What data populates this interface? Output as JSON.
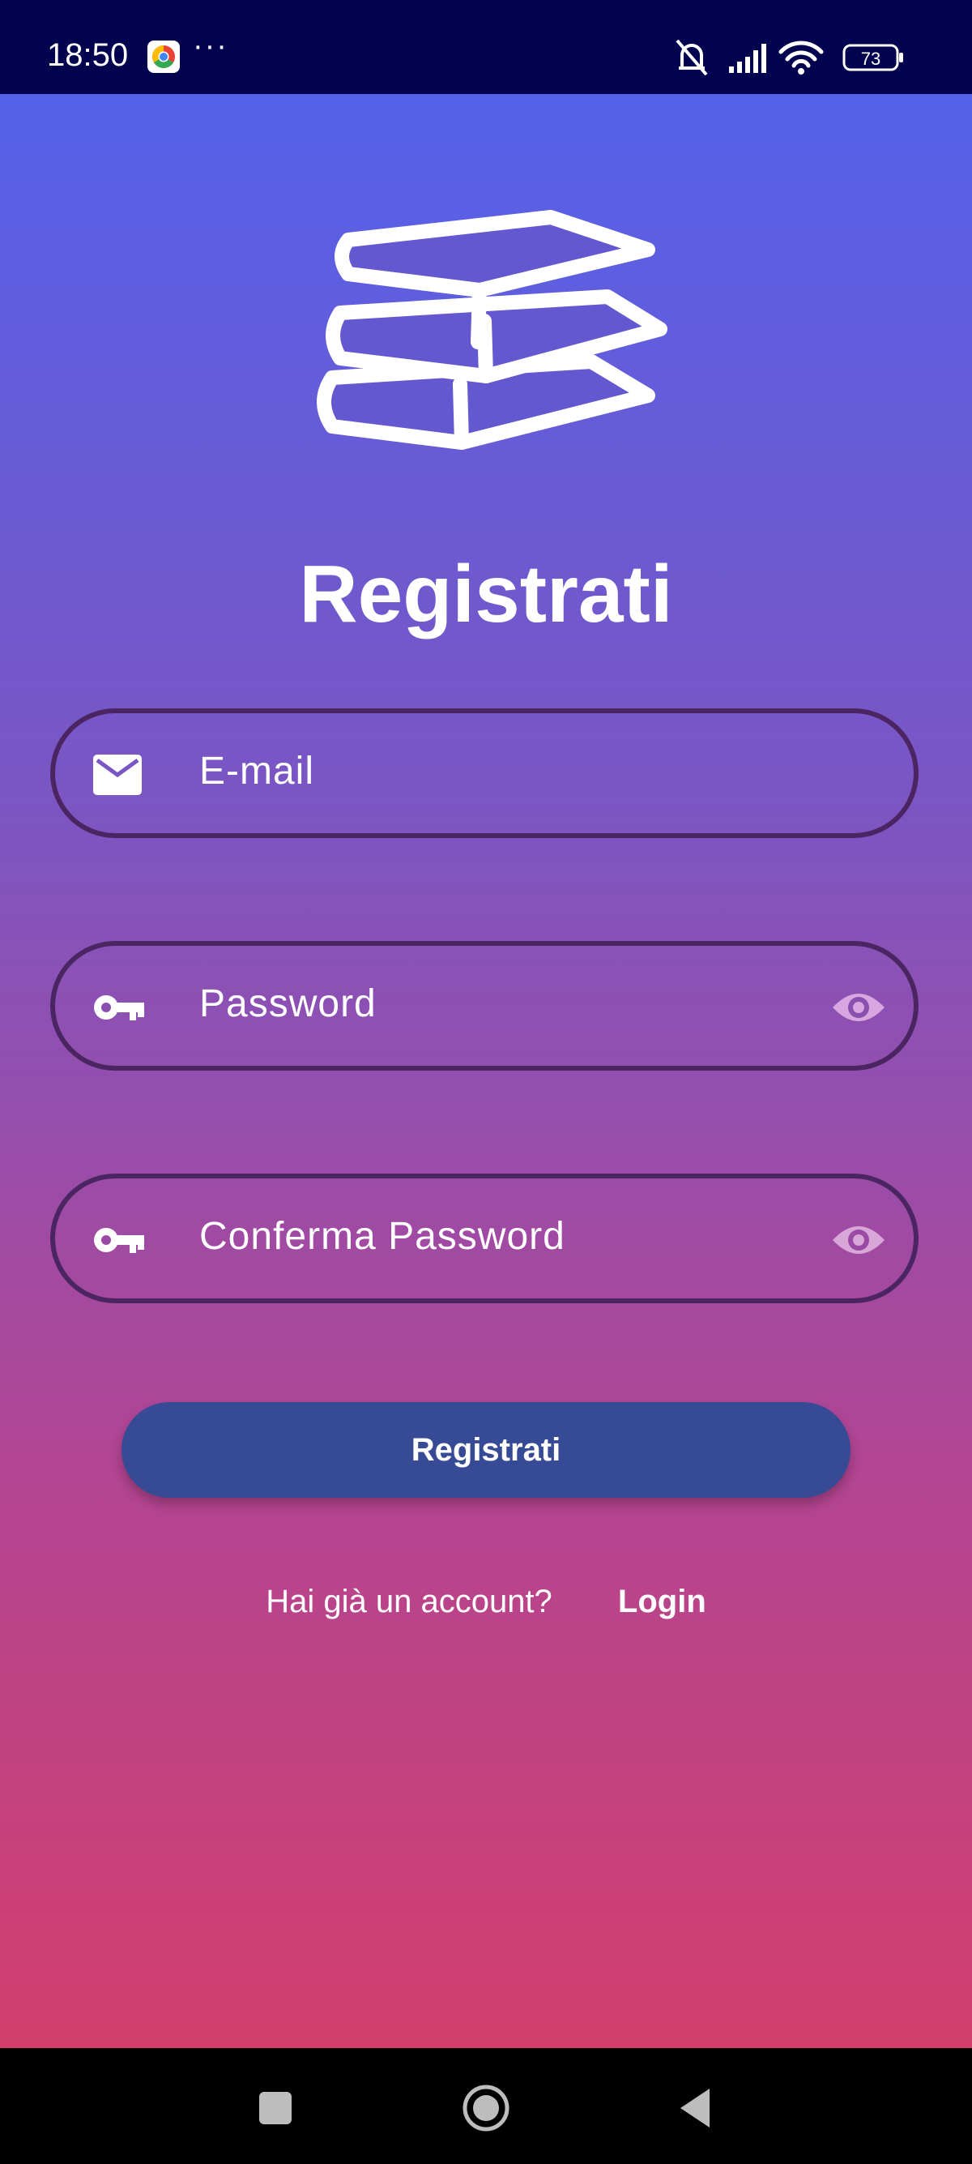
{
  "status_bar": {
    "time": "18:50",
    "more": "···",
    "battery": "73"
  },
  "logo": {
    "icon": "books-stack-icon"
  },
  "title": "Registrati",
  "form": {
    "email": {
      "placeholder": "E-mail",
      "icon": "mail-icon"
    },
    "password": {
      "placeholder": "Password",
      "icon": "key-icon",
      "toggle_icon": "eye-icon"
    },
    "confirm_password": {
      "placeholder": "Conferma Password",
      "icon": "key-icon",
      "toggle_icon": "eye-icon"
    },
    "submit_label": "Registrati"
  },
  "login_prompt": {
    "question": "Hai già un account?",
    "link": "Login"
  },
  "colors": {
    "status_bar": "#02024f",
    "gradient_top": "#5461ea",
    "gradient_bottom": "#d23f6d",
    "button": "#374a95",
    "field_border": "#4a2562"
  }
}
